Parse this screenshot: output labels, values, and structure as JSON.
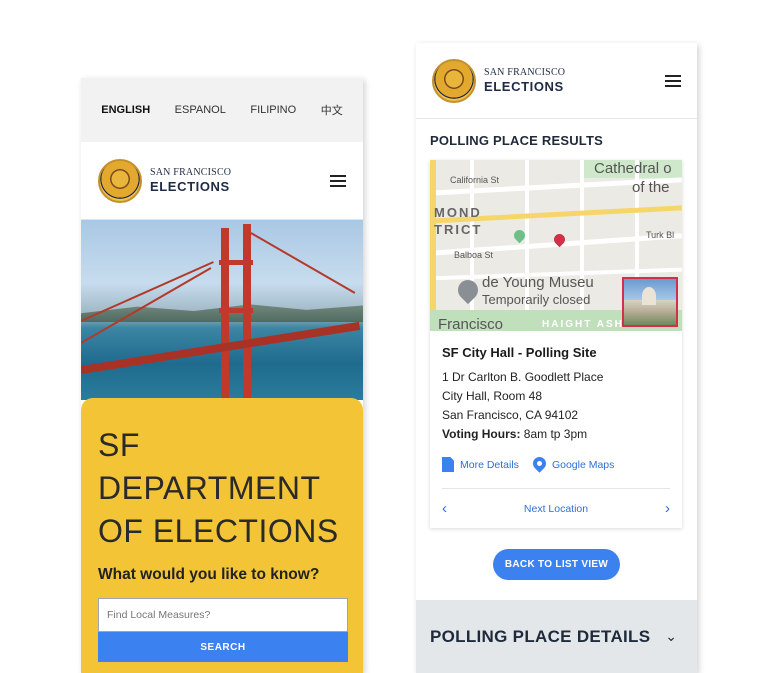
{
  "colors": {
    "accent": "#3b82f0",
    "hero_panel": "#f3c536",
    "details_bar": "#e4e7ea",
    "map_pin": "#d0304a"
  },
  "left_screen": {
    "languages": [
      "ENGLISH",
      "ESPANOL",
      "FILIPINO",
      "中文"
    ],
    "active_language": "ENGLISH",
    "brand": {
      "line1": "SAN FRANCISCO",
      "line2": "ELECTIONS"
    },
    "hero": {
      "title_lines": [
        "SF",
        "DEPARTMENT",
        "OF ELECTIONS"
      ],
      "question": "What would you like to know?",
      "search_placeholder": "Find Local Measures?",
      "search_button": "SEARCH"
    }
  },
  "right_screen": {
    "brand": {
      "line1": "SAN FRANCISCO",
      "line2": "ELECTIONS"
    },
    "section_title": "POLLING PLACE RESULTS",
    "map": {
      "labels": [
        "Cathedral o",
        "of the",
        "California St",
        "MOND",
        "TRICT",
        "Turk Bl",
        "Balboa St",
        "de Young Museu",
        "Temporarily closed",
        "Francisco",
        "HAIGHT ASHBU"
      ]
    },
    "result": {
      "name": "SF City Hall - Polling Site",
      "address_lines": [
        "1 Dr Carlton B. Goodlett Place",
        "City Hall, Room 48",
        "San Francisco, CA 94102"
      ],
      "hours_label": "Voting Hours:",
      "hours_value": "8am tp 3pm",
      "more_details": "More Details",
      "google_maps": "Google Maps",
      "next_location": "Next Location"
    },
    "back_button": "BACK TO LIST VIEW",
    "details_title": "POLLING PLACE DETAILS"
  }
}
